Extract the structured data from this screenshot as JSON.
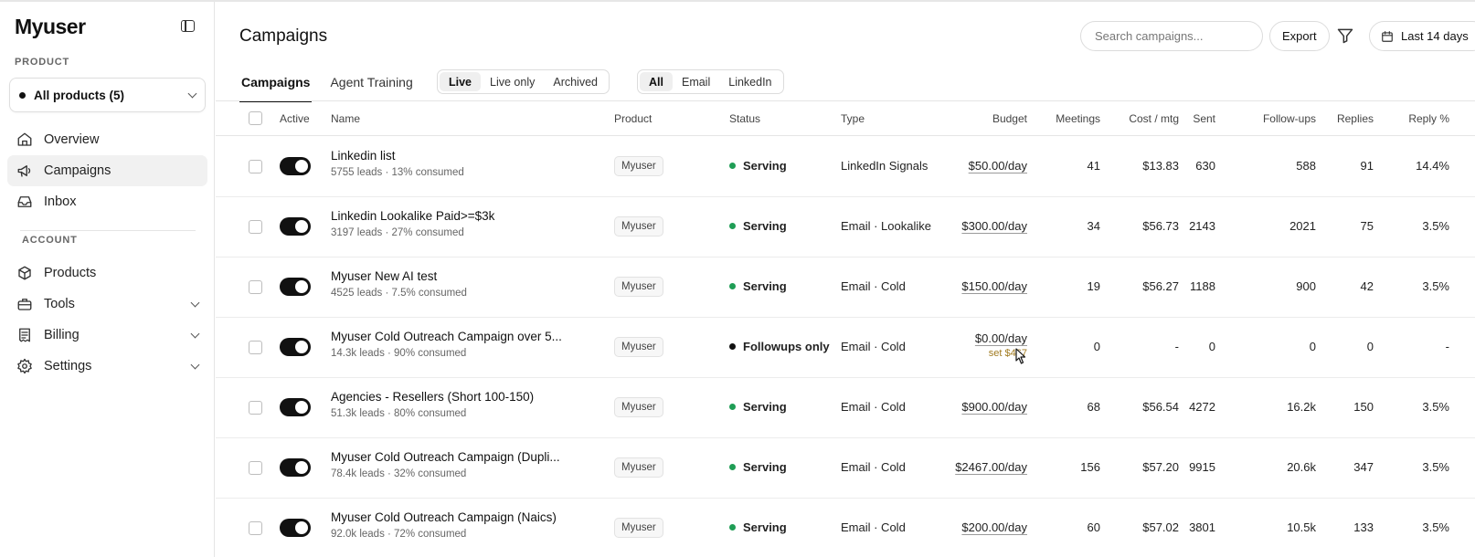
{
  "app": {
    "logo": "Myuser",
    "sidebar": {
      "product_section": "PRODUCT",
      "product_select": "All products (5)",
      "nav": [
        {
          "label": "Overview",
          "icon": "dashboard-icon"
        },
        {
          "label": "Campaigns",
          "icon": "megaphone-icon"
        },
        {
          "label": "Inbox",
          "icon": "inbox-icon"
        }
      ],
      "account_section": "ACCOUNT",
      "account_nav": [
        {
          "label": "Products",
          "icon": "box-icon"
        },
        {
          "label": "Tools",
          "icon": "toolbox-icon"
        },
        {
          "label": "Billing",
          "icon": "receipt-icon"
        },
        {
          "label": "Settings",
          "icon": "gear-icon"
        }
      ]
    }
  },
  "header": {
    "title": "Campaigns",
    "search_placeholder": "Search campaigns...",
    "export_label": "Export",
    "date_range_label": "Last 14 days"
  },
  "tabs": [
    "Campaigns",
    "Agent Training"
  ],
  "status_filter": [
    "Live",
    "Live only",
    "Archived"
  ],
  "channel_filter": [
    "All",
    "Email",
    "LinkedIn"
  ],
  "table": {
    "columns": [
      "Active",
      "Name",
      "Product",
      "Status",
      "Type",
      "Budget",
      "Meetings",
      "Cost / mtg",
      "Sent",
      "Follow-ups",
      "Replies",
      "Reply %"
    ],
    "rows": [
      {
        "name": "Linkedin list",
        "sub": "5755 leads · 13% consumed",
        "product": "Myuser",
        "status": "Serving",
        "type": "LinkedIn Signals",
        "budget": "$50.00/day",
        "budget_note": "",
        "meetings": "41",
        "cost": "$13.83",
        "sent": "630",
        "followups": "588",
        "replies": "91",
        "reply_pct": "14.4%"
      },
      {
        "name": "Linkedin Lookalike Paid>=$3k",
        "sub": "3197 leads · 27% consumed",
        "product": "Myuser",
        "status": "Serving",
        "type": "Email · Lookalike",
        "budget": "$300.00/day",
        "budget_note": "",
        "meetings": "34",
        "cost": "$56.73",
        "sent": "2143",
        "followups": "2021",
        "replies": "75",
        "reply_pct": "3.5%"
      },
      {
        "name": "Myuser New AI test",
        "sub": "4525 leads · 7.5% consumed",
        "product": "Myuser",
        "status": "Serving",
        "type": "Email · Cold",
        "budget": "$150.00/day",
        "budget_note": "",
        "meetings": "19",
        "cost": "$56.27",
        "sent": "1188",
        "followups": "900",
        "replies": "42",
        "reply_pct": "3.5%"
      },
      {
        "name": "Myuser Cold Outreach Campaign over 5...",
        "sub": "14.3k leads · 90% consumed",
        "product": "Myuser",
        "status": "Followups only",
        "type": "Email · Cold",
        "budget": "$0.00/day",
        "budget_note": "set $467",
        "meetings": "0",
        "cost": "-",
        "sent": "0",
        "followups": "0",
        "replies": "0",
        "reply_pct": "-"
      },
      {
        "name": "Agencies - Resellers (Short 100-150)",
        "sub": "51.3k leads · 80% consumed",
        "product": "Myuser",
        "status": "Serving",
        "type": "Email · Cold",
        "budget": "$900.00/day",
        "budget_note": "",
        "meetings": "68",
        "cost": "$56.54",
        "sent": "4272",
        "followups": "16.2k",
        "replies": "150",
        "reply_pct": "3.5%"
      },
      {
        "name": "Myuser Cold Outreach Campaign (Dupli...",
        "sub": "78.4k leads · 32% consumed",
        "product": "Myuser",
        "status": "Serving",
        "type": "Email · Cold",
        "budget": "$2467.00/day",
        "budget_note": "",
        "meetings": "156",
        "cost": "$57.20",
        "sent": "9915",
        "followups": "20.6k",
        "replies": "347",
        "reply_pct": "3.5%"
      },
      {
        "name": "Myuser Cold Outreach Campaign (Naics)",
        "sub": "92.0k leads · 72% consumed",
        "product": "Myuser",
        "status": "Serving",
        "type": "Email · Cold",
        "budget": "$200.00/day",
        "budget_note": "",
        "meetings": "60",
        "cost": "$57.02",
        "sent": "3801",
        "followups": "10.5k",
        "replies": "133",
        "reply_pct": "3.5%"
      }
    ]
  },
  "colors": {
    "serving": "#1f9d55",
    "followups_only": "#111111",
    "budget_note": "#a07a1f",
    "toggle_on": "#111111"
  }
}
